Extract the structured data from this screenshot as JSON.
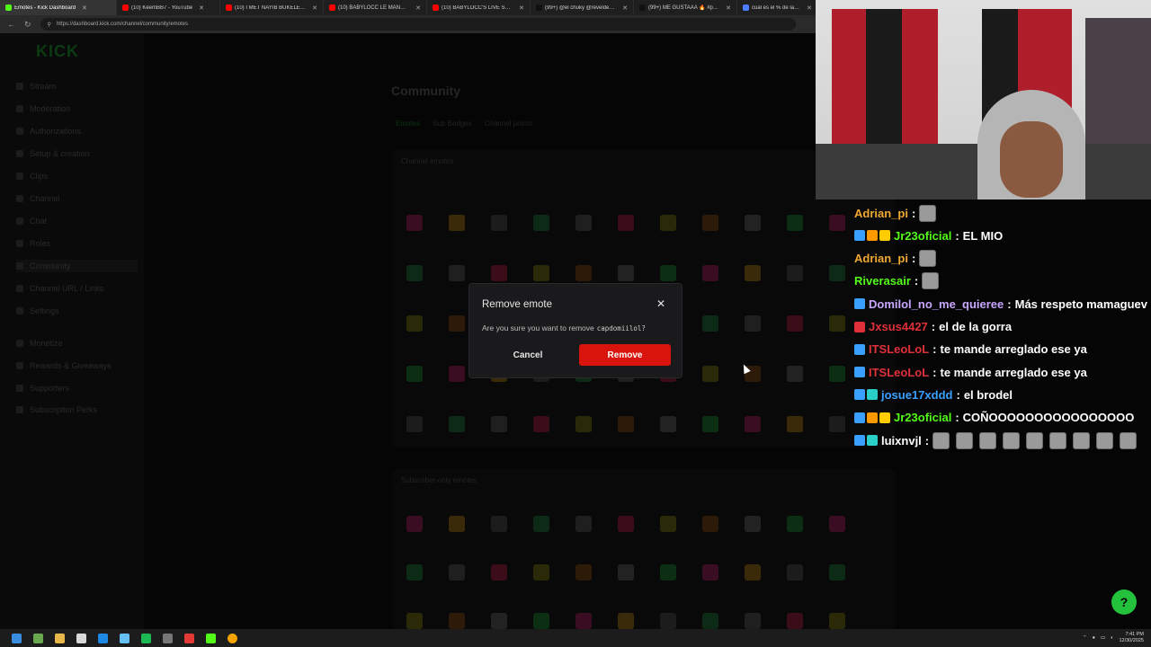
{
  "browser": {
    "tabs": [
      {
        "title": "Emotes - Kick Dashboard",
        "color": "#53fc18",
        "active": true
      },
      {
        "title": "(10) KeemBB7 - YouTube",
        "color": "#ff0000",
        "active": false
      },
      {
        "title": "(10) I MET NAYIB BUKELE (PRES",
        "color": "#ff0000",
        "active": false
      },
      {
        "title": "(10) BABYLOCC LE MANDA 🔥",
        "color": "#ff0000",
        "active": false
      },
      {
        "title": "(10) BABYLOCC'S LIVE STREAM",
        "color": "#ff0000",
        "active": false
      },
      {
        "title": "(99+) @el chuky @reveldeglo ®",
        "color": "#111111",
        "active": false
      },
      {
        "title": "(99+) ME GUSTAAA 🔥 #parra",
        "color": "#111111",
        "active": false
      },
      {
        "title": "cual es el % de la econo",
        "color": "#4a7dff",
        "active": false
      }
    ],
    "url": "https://dashboard.kick.com/channel/community/emotes"
  },
  "dashboard": {
    "logo": "KICK",
    "page_title": "Community",
    "subtabs": [
      "Emotes",
      "Sub Badges",
      "Channel points"
    ],
    "sidebar_items": [
      "Stream",
      "Moderation",
      "Authorizations",
      "Setup & creation",
      "Clips",
      "Channel",
      "Chat",
      "Roles",
      "Community",
      "Channel URL / Links",
      "Settings",
      "Monetize",
      "Rewards & Giveaways",
      "Supporters",
      "Subscription Perks"
    ],
    "panel1_title": "Channel emotes",
    "panel2_title": "Subscriber-only emotes"
  },
  "modal": {
    "title": "Remove emote",
    "question": "Are you sure you want to remove",
    "emote_code": "capdomiilol?",
    "cancel_label": "Cancel",
    "remove_label": "Remove"
  },
  "chat": {
    "messages": [
      {
        "user": "Adrian_pi",
        "user_color": "#f0a830",
        "text": "",
        "badges": [],
        "emojis": 1
      },
      {
        "user": "Jr23oficial",
        "user_color": "#53fc18",
        "text": "EL MIO",
        "badges": [
          "#3aa0ff",
          "#ff9900",
          "#ffcc00"
        ],
        "emojis": 0
      },
      {
        "user": "Adrian_pi",
        "user_color": "#f0a830",
        "text": "",
        "badges": [],
        "emojis": 1
      },
      {
        "user": "Riverasair",
        "user_color": "#53fc18",
        "text": "",
        "badges": [],
        "emojis": 1
      },
      {
        "user": "Domilol_no_me_quieree",
        "user_color": "#c9a6ff",
        "text": "Más respeto mamaguev",
        "badges": [
          "#3aa0ff"
        ],
        "emojis": 0
      },
      {
        "user": "Jxsus4427",
        "user_color": "#e0303a",
        "text": "el de la gorra",
        "badges": [
          "#e0303a"
        ],
        "emojis": 0
      },
      {
        "user": "ITSLeoLoL",
        "user_color": "#e0303a",
        "text": "te mande arreglado ese ya",
        "badges": [
          "#3aa0ff"
        ],
        "emojis": 0
      },
      {
        "user": "ITSLeoLoL",
        "user_color": "#e0303a",
        "text": "te mande arreglado ese ya",
        "badges": [
          "#3aa0ff"
        ],
        "emojis": 0
      },
      {
        "user": "josue17xddd",
        "user_color": "#3aa0ff",
        "text": "el brodel",
        "badges": [
          "#3aa0ff",
          "#2ad0c8"
        ],
        "emojis": 0
      },
      {
        "user": "Jr23oficial",
        "user_color": "#53fc18",
        "text": "COÑOOOOOOOOOOOOOOOO",
        "badges": [
          "#3aa0ff",
          "#ff9900",
          "#ffcc00"
        ],
        "emojis": 0
      },
      {
        "user": "luixnvjl",
        "user_color": "#ffffff",
        "text": "",
        "badges": [
          "#3aa0ff",
          "#2ad0c8"
        ],
        "emojis": 9
      }
    ]
  },
  "taskbar": {
    "time": "7:41 PM",
    "date": "12/30/2025"
  }
}
